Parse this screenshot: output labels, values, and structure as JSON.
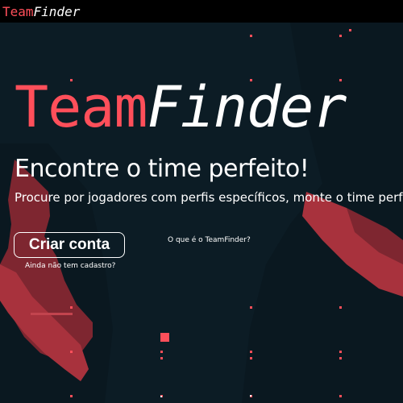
{
  "app": {
    "logo_part1": "Team",
    "logo_part2": "Finder"
  },
  "hero": {
    "title_part1": "Team",
    "title_part2": "Finder",
    "subtitle": "Encontre o time perfeito!",
    "description": "Procure por jogadores com perfis específicos, monte o time perfeito",
    "create_account_label": "Criar conta",
    "signup_hint": "Ainda não tem cadastro?",
    "about_link": "O que é o TeamFinder?"
  },
  "colors": {
    "accent": "#ff4f5a",
    "background": "#0c1c25",
    "figure": "#a8323d",
    "topbar": "#000000"
  }
}
